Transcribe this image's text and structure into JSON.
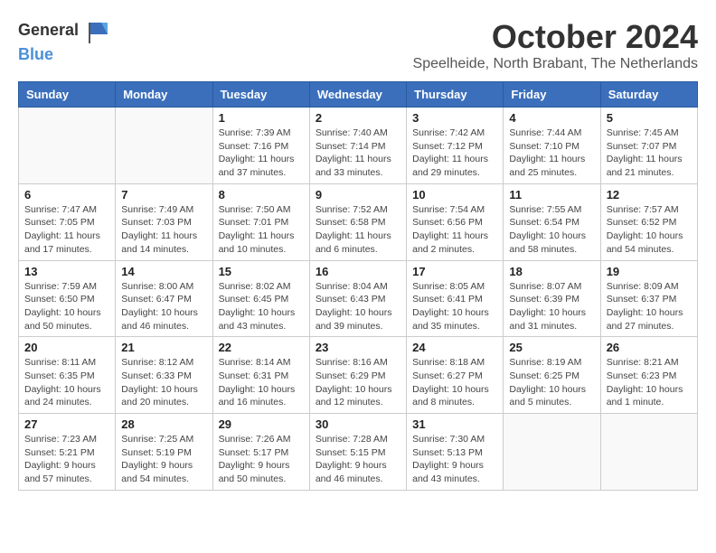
{
  "logo": {
    "general": "General",
    "blue": "Blue"
  },
  "header": {
    "month": "October 2024",
    "location": "Speelheide, North Brabant, The Netherlands"
  },
  "weekdays": [
    "Sunday",
    "Monday",
    "Tuesday",
    "Wednesday",
    "Thursday",
    "Friday",
    "Saturday"
  ],
  "weeks": [
    [
      {
        "day": "",
        "info": ""
      },
      {
        "day": "",
        "info": ""
      },
      {
        "day": "1",
        "info": "Sunrise: 7:39 AM\nSunset: 7:16 PM\nDaylight: 11 hours\nand 37 minutes."
      },
      {
        "day": "2",
        "info": "Sunrise: 7:40 AM\nSunset: 7:14 PM\nDaylight: 11 hours\nand 33 minutes."
      },
      {
        "day": "3",
        "info": "Sunrise: 7:42 AM\nSunset: 7:12 PM\nDaylight: 11 hours\nand 29 minutes."
      },
      {
        "day": "4",
        "info": "Sunrise: 7:44 AM\nSunset: 7:10 PM\nDaylight: 11 hours\nand 25 minutes."
      },
      {
        "day": "5",
        "info": "Sunrise: 7:45 AM\nSunset: 7:07 PM\nDaylight: 11 hours\nand 21 minutes."
      }
    ],
    [
      {
        "day": "6",
        "info": "Sunrise: 7:47 AM\nSunset: 7:05 PM\nDaylight: 11 hours\nand 17 minutes."
      },
      {
        "day": "7",
        "info": "Sunrise: 7:49 AM\nSunset: 7:03 PM\nDaylight: 11 hours\nand 14 minutes."
      },
      {
        "day": "8",
        "info": "Sunrise: 7:50 AM\nSunset: 7:01 PM\nDaylight: 11 hours\nand 10 minutes."
      },
      {
        "day": "9",
        "info": "Sunrise: 7:52 AM\nSunset: 6:58 PM\nDaylight: 11 hours\nand 6 minutes."
      },
      {
        "day": "10",
        "info": "Sunrise: 7:54 AM\nSunset: 6:56 PM\nDaylight: 11 hours\nand 2 minutes."
      },
      {
        "day": "11",
        "info": "Sunrise: 7:55 AM\nSunset: 6:54 PM\nDaylight: 10 hours\nand 58 minutes."
      },
      {
        "day": "12",
        "info": "Sunrise: 7:57 AM\nSunset: 6:52 PM\nDaylight: 10 hours\nand 54 minutes."
      }
    ],
    [
      {
        "day": "13",
        "info": "Sunrise: 7:59 AM\nSunset: 6:50 PM\nDaylight: 10 hours\nand 50 minutes."
      },
      {
        "day": "14",
        "info": "Sunrise: 8:00 AM\nSunset: 6:47 PM\nDaylight: 10 hours\nand 46 minutes."
      },
      {
        "day": "15",
        "info": "Sunrise: 8:02 AM\nSunset: 6:45 PM\nDaylight: 10 hours\nand 43 minutes."
      },
      {
        "day": "16",
        "info": "Sunrise: 8:04 AM\nSunset: 6:43 PM\nDaylight: 10 hours\nand 39 minutes."
      },
      {
        "day": "17",
        "info": "Sunrise: 8:05 AM\nSunset: 6:41 PM\nDaylight: 10 hours\nand 35 minutes."
      },
      {
        "day": "18",
        "info": "Sunrise: 8:07 AM\nSunset: 6:39 PM\nDaylight: 10 hours\nand 31 minutes."
      },
      {
        "day": "19",
        "info": "Sunrise: 8:09 AM\nSunset: 6:37 PM\nDaylight: 10 hours\nand 27 minutes."
      }
    ],
    [
      {
        "day": "20",
        "info": "Sunrise: 8:11 AM\nSunset: 6:35 PM\nDaylight: 10 hours\nand 24 minutes."
      },
      {
        "day": "21",
        "info": "Sunrise: 8:12 AM\nSunset: 6:33 PM\nDaylight: 10 hours\nand 20 minutes."
      },
      {
        "day": "22",
        "info": "Sunrise: 8:14 AM\nSunset: 6:31 PM\nDaylight: 10 hours\nand 16 minutes."
      },
      {
        "day": "23",
        "info": "Sunrise: 8:16 AM\nSunset: 6:29 PM\nDaylight: 10 hours\nand 12 minutes."
      },
      {
        "day": "24",
        "info": "Sunrise: 8:18 AM\nSunset: 6:27 PM\nDaylight: 10 hours\nand 8 minutes."
      },
      {
        "day": "25",
        "info": "Sunrise: 8:19 AM\nSunset: 6:25 PM\nDaylight: 10 hours\nand 5 minutes."
      },
      {
        "day": "26",
        "info": "Sunrise: 8:21 AM\nSunset: 6:23 PM\nDaylight: 10 hours\nand 1 minute."
      }
    ],
    [
      {
        "day": "27",
        "info": "Sunrise: 7:23 AM\nSunset: 5:21 PM\nDaylight: 9 hours\nand 57 minutes."
      },
      {
        "day": "28",
        "info": "Sunrise: 7:25 AM\nSunset: 5:19 PM\nDaylight: 9 hours\nand 54 minutes."
      },
      {
        "day": "29",
        "info": "Sunrise: 7:26 AM\nSunset: 5:17 PM\nDaylight: 9 hours\nand 50 minutes."
      },
      {
        "day": "30",
        "info": "Sunrise: 7:28 AM\nSunset: 5:15 PM\nDaylight: 9 hours\nand 46 minutes."
      },
      {
        "day": "31",
        "info": "Sunrise: 7:30 AM\nSunset: 5:13 PM\nDaylight: 9 hours\nand 43 minutes."
      },
      {
        "day": "",
        "info": ""
      },
      {
        "day": "",
        "info": ""
      }
    ]
  ]
}
